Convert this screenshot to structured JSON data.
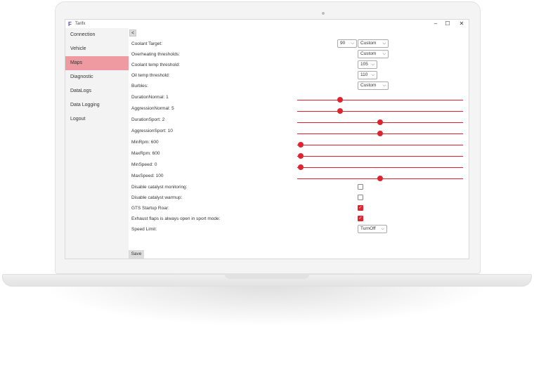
{
  "window": {
    "title": "Tarifx",
    "minimize": "–",
    "maximize": "☐",
    "close": "✕"
  },
  "sidebar": {
    "items": [
      {
        "label": "Connection"
      },
      {
        "label": "Vehicle"
      },
      {
        "label": "Maps",
        "active": true
      },
      {
        "label": "Diagnostic"
      },
      {
        "label": "DataLogs"
      },
      {
        "label": "Data Logging"
      },
      {
        "label": "Logout"
      }
    ]
  },
  "main": {
    "back_label": "<",
    "coolant_target": {
      "label": "Coolant Target:",
      "value": "90",
      "mode": "Custom"
    },
    "overheating": {
      "label": "Overheating thresholds:",
      "mode": "Custom"
    },
    "coolant_temp": {
      "label": "Coolant temp threshold:",
      "value": "105"
    },
    "oil_temp": {
      "label": "Oil temp threshold:",
      "value": "110"
    },
    "burbles": {
      "label": "Burbles:",
      "mode": "Custom"
    },
    "sliders": [
      {
        "label": "DurationNormal: 1",
        "fraction": 0.26
      },
      {
        "label": "AggressionNormal: 5",
        "fraction": 0.26
      },
      {
        "label": "DurationSport: 2",
        "fraction": 0.5
      },
      {
        "label": "AggressionSport: 10",
        "fraction": 0.5
      },
      {
        "label": "MinRpm: 600",
        "fraction": 0.02
      },
      {
        "label": "MaxRpm: 600",
        "fraction": 0.02
      },
      {
        "label": "MinSpeed: 0",
        "fraction": 0.02
      },
      {
        "label": "MaxSpeed: 100",
        "fraction": 0.5
      }
    ],
    "checkboxes": [
      {
        "label": "Disable catalyst monitoring:",
        "checked": false
      },
      {
        "label": "Disable catalyst warmup:",
        "checked": false
      },
      {
        "label": "GTS Startup Roar:",
        "checked": true
      },
      {
        "label": "Exhaust flaps is always open in sport mode:",
        "checked": true
      }
    ],
    "speed_limit": {
      "label": "Speed Limit:",
      "value": "TurnOff"
    },
    "save_label": "Save"
  },
  "colors": {
    "accent": "#e0242f",
    "active_nav": "#ef9aa0"
  },
  "icons": {
    "chevron": "chevron-down-icon",
    "check": "checkmark-icon",
    "logo": "app-logo-icon"
  }
}
